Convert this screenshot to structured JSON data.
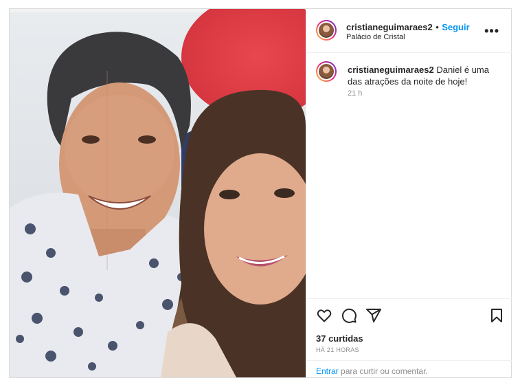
{
  "post": {
    "username": "cristianeguimaraes2",
    "dot": "•",
    "follow_label": "Seguir",
    "location": "Palácio de Cristal",
    "more_label": "•••",
    "caption_username": "cristianeguimaraes2",
    "caption_text": " Daniel é uma das atrações da noite de hoje!",
    "caption_time": "21 h",
    "likes": "37 curtidas",
    "timeago": "HÁ 21 HORAS",
    "login_link": "Entrar",
    "login_text": " para curtir ou comentar."
  },
  "icons": {
    "more": "more-icon",
    "like": "heart-icon",
    "comment": "comment-icon",
    "share": "share-icon",
    "save": "bookmark-icon"
  },
  "colors": {
    "accent": "#0095f6",
    "text": "#262626",
    "muted": "#8e8e8e",
    "border": "#dbdbdb"
  }
}
